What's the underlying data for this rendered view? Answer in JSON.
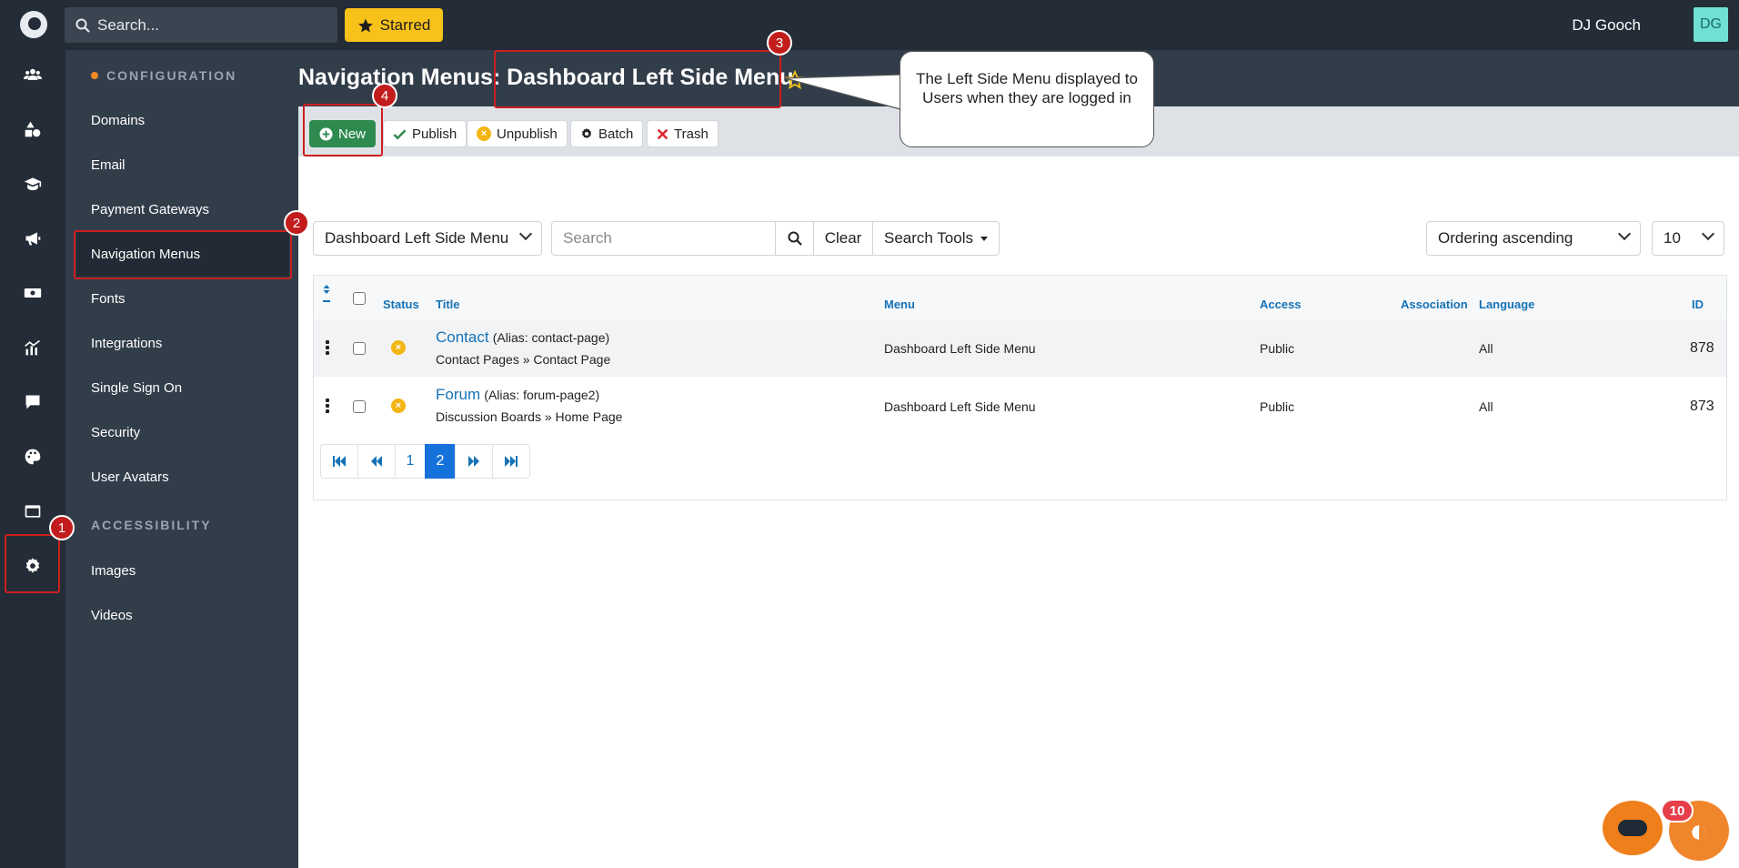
{
  "topbar": {
    "search_placeholder": "Search...",
    "starred_label": "Starred",
    "user_name": "DJ Gooch",
    "user_initials": "DG"
  },
  "rail": {
    "icons": [
      "users-icon",
      "shapes-icon",
      "graduation-cap-icon",
      "megaphone-icon",
      "money-icon",
      "chart-icon",
      "chat-icon",
      "palette-icon",
      "window-icon",
      "gear-icon"
    ]
  },
  "sidebar": {
    "section_configuration": "CONFIGURATION",
    "items": [
      {
        "label": "Domains"
      },
      {
        "label": "Email"
      },
      {
        "label": "Payment Gateways"
      },
      {
        "label": "Navigation Menus"
      },
      {
        "label": "Fonts"
      },
      {
        "label": "Integrations"
      },
      {
        "label": "Single Sign On"
      },
      {
        "label": "Security"
      },
      {
        "label": "User Avatars"
      }
    ],
    "section_accessibility": "ACCESSIBILITY",
    "accessibility_items": [
      {
        "label": "Images"
      },
      {
        "label": "Videos"
      }
    ]
  },
  "page": {
    "title": "Navigation Menus: Dashboard Left Side Menu"
  },
  "toolbar": {
    "new_label": "New",
    "publish_label": "Publish",
    "unpublish_label": "Unpublish",
    "batch_label": "Batch",
    "trash_label": "Trash"
  },
  "filters": {
    "menu_select": "Dashboard Left Side Menu",
    "search_placeholder": "Search",
    "clear_label": "Clear",
    "search_tools_label": "Search Tools",
    "ordering_select": "Ordering ascending",
    "limit_select": "10"
  },
  "table": {
    "headers": {
      "status": "Status",
      "title": "Title",
      "menu": "Menu",
      "access": "Access",
      "association": "Association",
      "language": "Language",
      "id": "ID"
    },
    "rows": [
      {
        "title": "Contact",
        "alias": "(Alias: contact-page)",
        "path": "Contact Pages » Contact Page",
        "menu": "Dashboard Left Side Menu",
        "access": "Public",
        "language": "All",
        "id": "878"
      },
      {
        "title": "Forum",
        "alias": "(Alias: forum-page2)",
        "path": "Discussion Boards » Home Page",
        "menu": "Dashboard Left Side Menu",
        "access": "Public",
        "language": "All",
        "id": "873"
      }
    ]
  },
  "pagination": {
    "pages": [
      "1",
      "2"
    ],
    "current": "2"
  },
  "annotations": {
    "badges": [
      "1",
      "2",
      "3",
      "4"
    ],
    "callout": "The Left Side Menu displayed to Users when they are logged in",
    "color": "#cc1f1f"
  },
  "chat": {
    "count": "10"
  },
  "colors": {
    "accent_blue": "#1672b6",
    "new_green": "#2e8a4f",
    "starred_yellow": "#f8c21a",
    "config_dot": "#f08a24"
  }
}
